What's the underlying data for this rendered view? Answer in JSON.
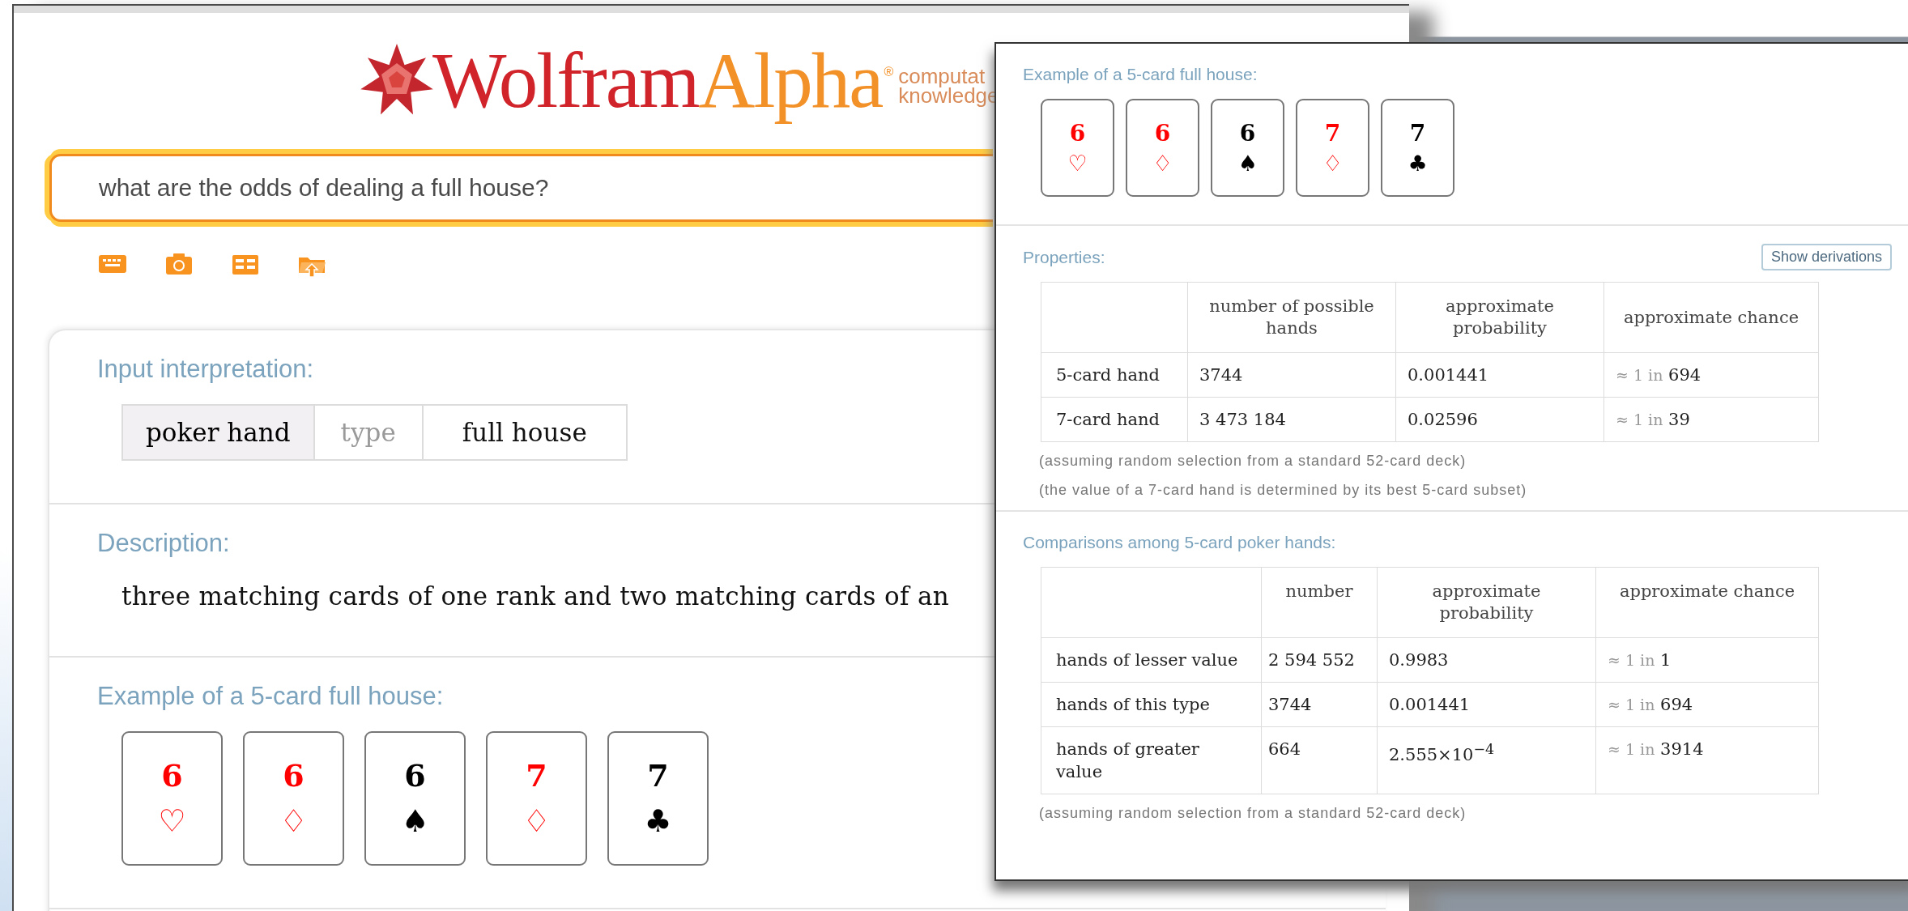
{
  "search_window": {
    "logo": {
      "word_1": "Wolfram",
      "word_2": "Alpha",
      "mark": "®",
      "tagline": [
        "computat",
        "knowledge"
      ]
    },
    "search_field": {
      "value": "what are the odds of dealing a full house?"
    },
    "pods": [
      {
        "kind": "interpretation",
        "title": "Input interpretation:",
        "chips": [
          {
            "text": "poker hand",
            "kind": "entity"
          },
          {
            "text": "type",
            "kind": "property"
          },
          {
            "text": "full house",
            "kind": "value"
          }
        ]
      },
      {
        "kind": "text",
        "title": "Description:",
        "text": "three matching cards of one rank and two matching cards of an"
      },
      {
        "kind": "cards",
        "title": "Example of a 5-card full house:",
        "cards": [
          {
            "rank": "6",
            "suit": "♡",
            "color": "#ff0000"
          },
          {
            "rank": "6",
            "suit": "♢",
            "color": "#ff0000"
          },
          {
            "rank": "6",
            "suit": "♠",
            "color": "#000000"
          },
          {
            "rank": "7",
            "suit": "♢",
            "color": "#ff0000"
          },
          {
            "rank": "7",
            "suit": "♣",
            "color": "#000000"
          }
        ]
      }
    ]
  },
  "result_window": {
    "pods": [
      {
        "kind": "cards",
        "title": "Example of a 5-card full house:",
        "cards": [
          {
            "rank": "6",
            "suit": "♡",
            "color": "#ff0000"
          },
          {
            "rank": "6",
            "suit": "♢",
            "color": "#ff0000"
          },
          {
            "rank": "6",
            "suit": "♠",
            "color": "#000000"
          },
          {
            "rank": "7",
            "suit": "♢",
            "color": "#ff0000"
          },
          {
            "rank": "7",
            "suit": "♣",
            "color": "#000000"
          }
        ]
      },
      {
        "kind": "table",
        "title": "Properties:",
        "button": "Show derivations",
        "table": {
          "columns": [
            "number of possible hands",
            "approximate probability",
            "approximate chance"
          ],
          "rows": [
            {
              "label": "5-card hand",
              "number": "3744",
              "probability": "0.001441",
              "chance": {
                "approx": "≈ 1 in",
                "value": "694"
              }
            },
            {
              "label": "7-card hand",
              "number": "3 473 184",
              "probability": "0.02596",
              "chance": {
                "approx": "≈ 1 in",
                "value": "39"
              }
            }
          ]
        },
        "notes": [
          "(assuming random selection from a standard 52-card deck)",
          "(the value of a 7-card hand is determined by its best 5-card subset)"
        ]
      },
      {
        "kind": "table",
        "title": "Comparisons among 5-card poker hands:",
        "table": {
          "columns": [
            "number",
            "approximate probability",
            "approximate chance"
          ],
          "rows": [
            {
              "label": "hands of lesser value",
              "number": "2 594 552",
              "probability": "0.9983",
              "chance": {
                "approx": "≈ 1 in",
                "value": "1"
              }
            },
            {
              "label": "hands of this type",
              "number": "3744",
              "probability": "0.001441",
              "chance": {
                "approx": "≈ 1 in",
                "value": "694"
              }
            },
            {
              "label": "hands of greater value",
              "number": "664",
              "probability": "2.555×10$^{−4}$",
              "chance": {
                "approx": "≈ 1 in",
                "value": "3914"
              }
            }
          ]
        },
        "notes": [
          "(assuming random selection from a standard 52-card deck)"
        ]
      }
    ]
  }
}
